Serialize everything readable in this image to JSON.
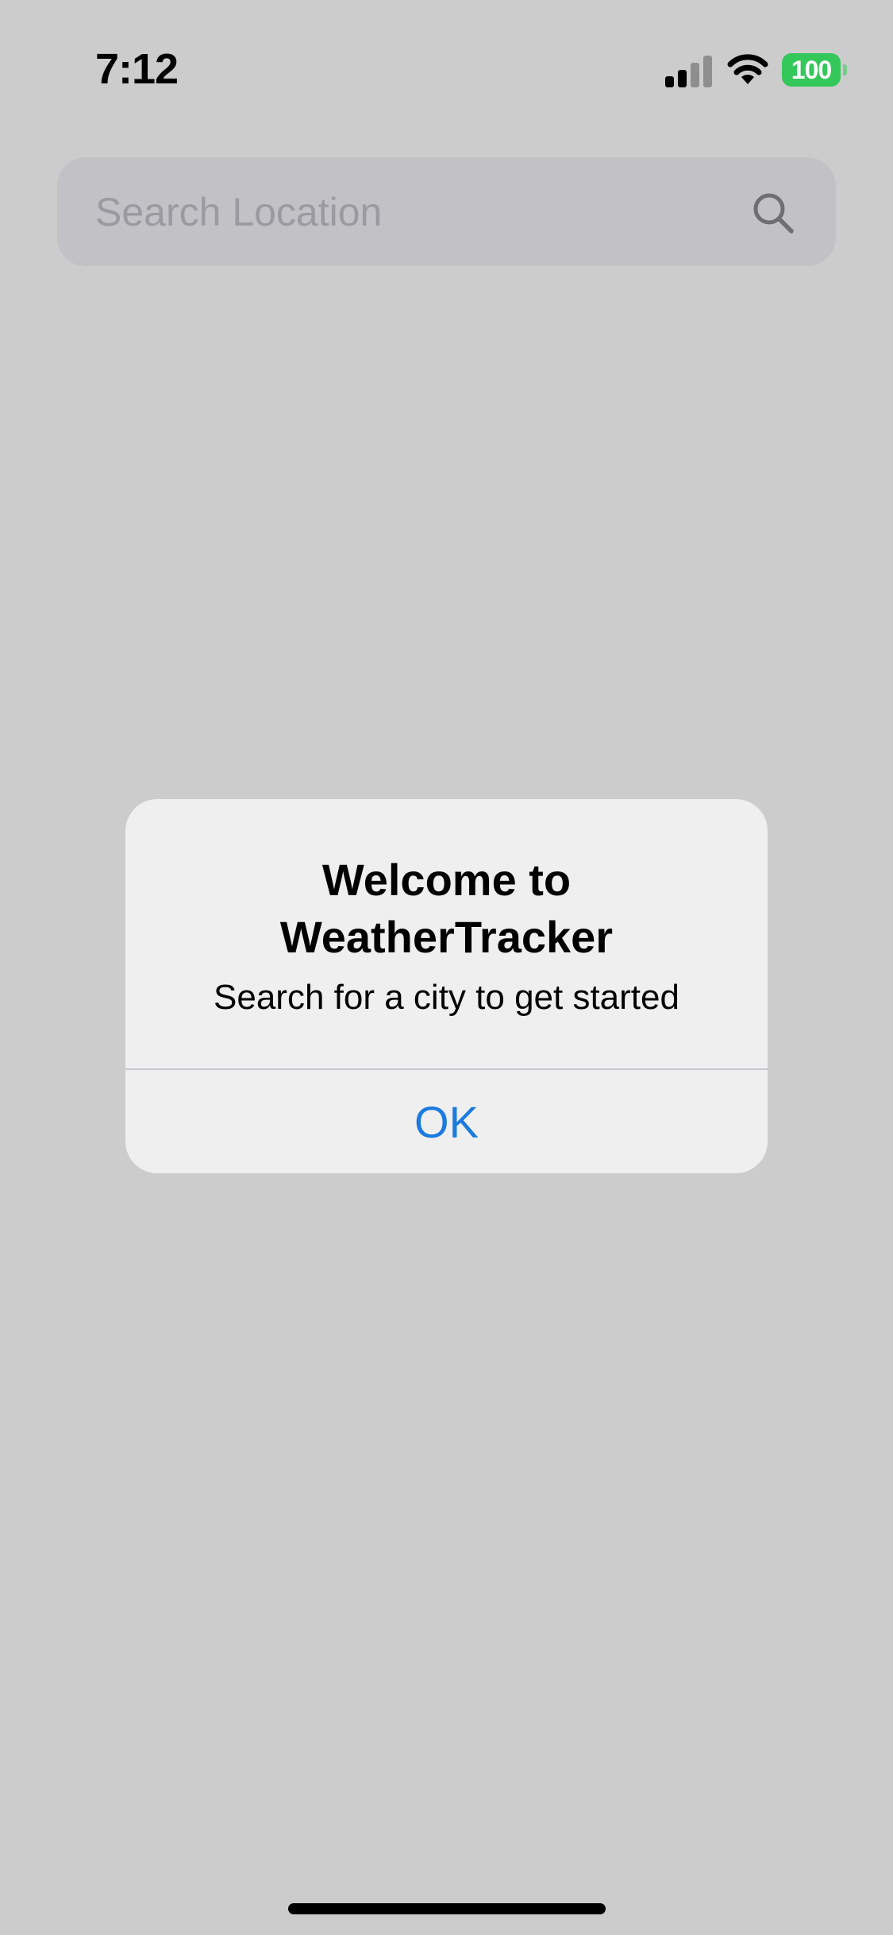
{
  "status_bar": {
    "time": "7:12",
    "battery_level": "100",
    "signal_icon": "cellular-signal-icon",
    "wifi_icon": "wifi-icon",
    "battery_color": "#34c759"
  },
  "search": {
    "placeholder": "Search Location",
    "icon": "magnifying-glass-icon"
  },
  "alert": {
    "title": "Welcome to WeatherTracker",
    "message": "Search for a city to get started",
    "ok_label": "OK",
    "ok_color": "#1a7ae0"
  }
}
